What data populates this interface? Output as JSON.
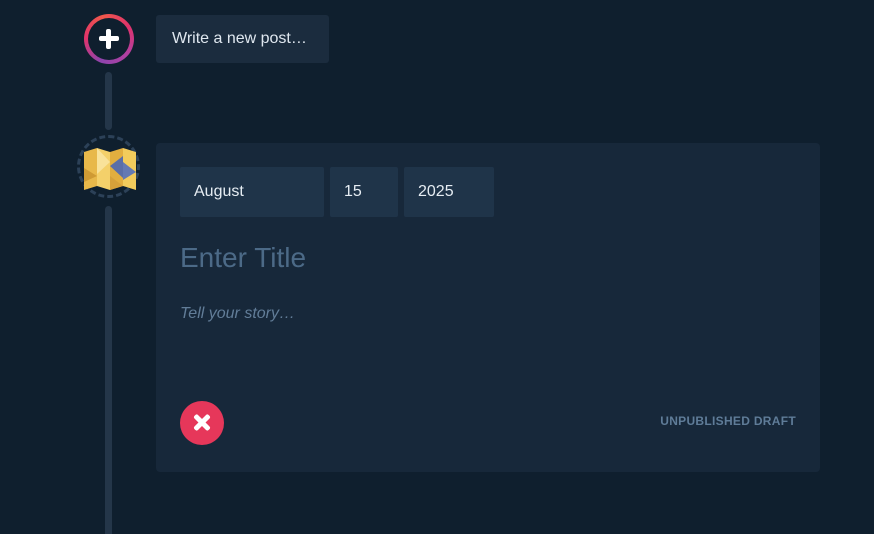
{
  "new_post": {
    "button_label": "Write a new post…",
    "icon": "plus-icon"
  },
  "editor": {
    "avatar_icon": "folded-map-icon",
    "date": {
      "month": "August",
      "day": "15",
      "year": "2025"
    },
    "title_placeholder": "Enter Title",
    "body_placeholder": "Tell your story…",
    "status": "UNPUBLISHED DRAFT",
    "cancel_icon": "close-icon"
  },
  "colors": {
    "background": "#0f1f2e",
    "card": "#17283a",
    "field": "#1f3449",
    "accent_red": "#e6375a"
  }
}
